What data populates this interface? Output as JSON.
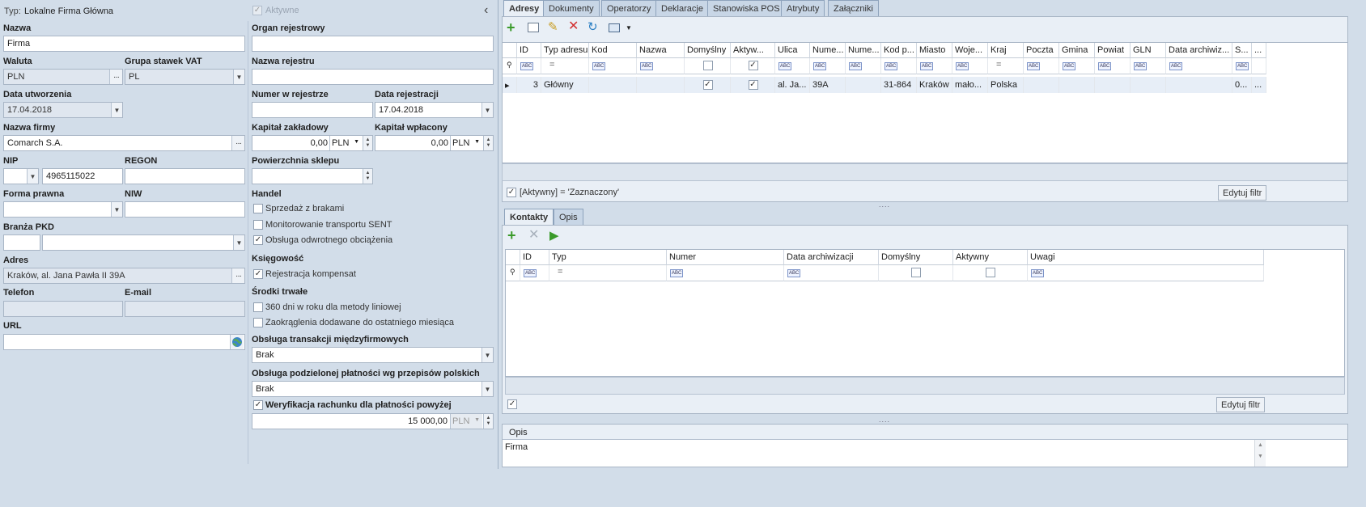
{
  "left": {
    "typ_label": "Typ:",
    "typ_value": "Lokalne Firma Główna",
    "aktywne_label": "Aktywne",
    "collapse_glyph": "‹",
    "nazwa_label": "Nazwa",
    "nazwa_value": "Firma",
    "waluta_label": "Waluta",
    "waluta_value": "PLN",
    "grupa_vat_label": "Grupa stawek VAT",
    "grupa_vat_value": "PL",
    "data_utw_label": "Data utworzenia",
    "data_utw_value": "17.04.2018",
    "nazwa_firmy_label": "Nazwa firmy",
    "nazwa_firmy_value": "Comarch S.A.",
    "nip_label": "NIP",
    "nip_value": "4965115022",
    "regon_label": "REGON",
    "forma_label": "Forma prawna",
    "niw_label": "NIW",
    "branza_label": "Branża PKD",
    "adres_label": "Adres",
    "adres_value": "Kraków, al. Jana Pawła II 39A",
    "telefon_label": "Telefon",
    "email_label": "E-mail",
    "url_label": "URL"
  },
  "middle": {
    "organ_label": "Organ rejestrowy",
    "nazwa_rej_label": "Nazwa rejestru",
    "numer_rej_label": "Numer w rejestrze",
    "data_rej_label": "Data rejestracji",
    "data_rej_value": "17.04.2018",
    "kap_zakl_label": "Kapitał zakładowy",
    "kap_zakl_value": "0,00",
    "kap_zakl_cur": "PLN",
    "kap_wpl_label": "Kapitał wpłacony",
    "kap_wpl_value": "0,00",
    "kap_wpl_cur": "PLN",
    "powierzchnia_label": "Powierzchnia sklepu",
    "handel_label": "Handel",
    "sprzedaz": "Sprzedaż z brakami",
    "monitorowanie": "Monitorowanie transportu SENT",
    "odwrotne": "Obsługa odwrotnego obciążenia",
    "ksiegowosc_label": "Księgowość",
    "kompensat": "Rejestracja kompensat",
    "srodki_label": "Środki trwałe",
    "dni360": "360 dni w roku dla metody liniowej",
    "zaokraglenia": "Zaokrąglenia dodawane do ostatniego miesiąca",
    "transakcje_label": "Obsługa transakcji międzyfirmowych",
    "transakcje_value": "Brak",
    "podzielona_label": "Obsługa podzielonej płatności wg przepisów polskich",
    "podzielona_value": "Brak",
    "weryfikacja": "Weryfikacja rachunku dla płatności powyżej",
    "weryfikacja_value": "15 000,00",
    "weryfikacja_cur": "PLN"
  },
  "tabs": [
    "Adresy",
    "Dokumenty",
    "Operatorzy",
    "Deklaracje",
    "Stanowiska POS",
    "Atrybuty",
    "Załączniki"
  ],
  "addresses": {
    "columns": [
      "ID",
      "Typ adresu",
      "Kod",
      "Nazwa",
      "Domyślny",
      "Aktyw...",
      "Ulica",
      "Nume...",
      "Nume...",
      "Kod p...",
      "Miasto",
      "Woje...",
      "Kraj",
      "Poczta",
      "Gmina",
      "Powiat",
      "GLN",
      "Data archiwiz...",
      "S...",
      "..."
    ],
    "row": [
      "3",
      "Główny",
      "",
      "",
      "",
      "",
      "al. Ja...",
      "39A",
      "",
      "31-864",
      "Kraków",
      "mało...",
      "Polska",
      "",
      "",
      "",
      "",
      "",
      "0...",
      "..."
    ],
    "filter_text": "[Aktywny] = 'Zaznaczony'",
    "edit_filter": "Edytuj filtr"
  },
  "contact_tabs": [
    "Kontakty",
    "Opis"
  ],
  "contacts": {
    "columns": [
      "ID",
      "Typ",
      "Numer",
      "Data archiwizacji",
      "Domyślny",
      "Aktywny",
      "Uwagi"
    ],
    "edit_filter": "Edytuj filtr"
  },
  "opis": {
    "label": "Opis",
    "value": "Firma"
  },
  "icons": {
    "abc": "ABC",
    "eq": "="
  }
}
